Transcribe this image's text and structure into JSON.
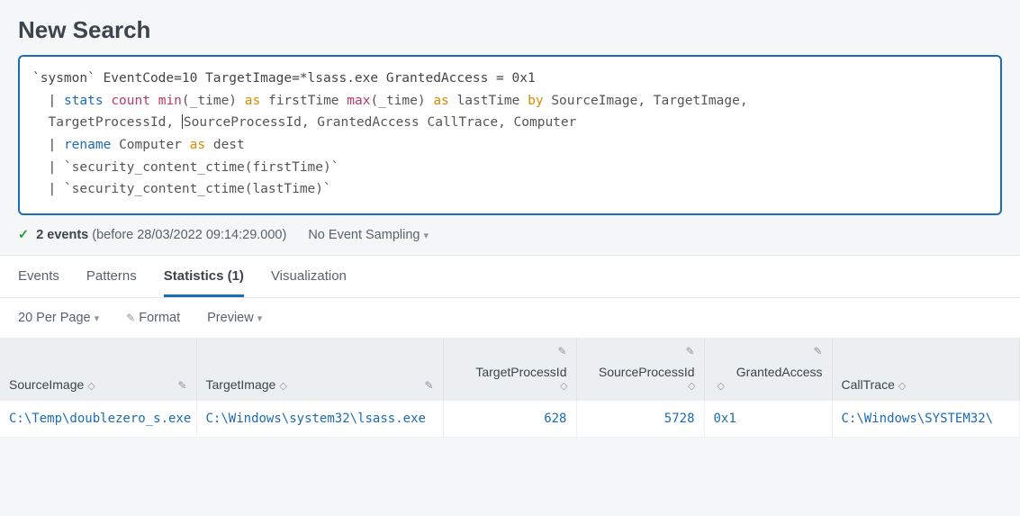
{
  "page_title": "New Search",
  "search_query": {
    "line1": "`sysmon` EventCode=10 TargetImage=*lsass.exe GrantedAccess = 0x1",
    "pipe": "|",
    "stats": "stats",
    "count": "count",
    "min": "min",
    "min_arg": "(_time)",
    "as": "as",
    "firstTime": "firstTime",
    "max": "max",
    "max_arg": "(_time)",
    "lastTime": "lastTime",
    "by": "by",
    "by_fields1": "SourceImage, TargetImage,",
    "by_fields2": "TargetProcessId, ",
    "by_fields2b": "SourceProcessId, GrantedAccess CallTrace, Computer",
    "rename": "rename",
    "rename_rest": "Computer",
    "dest": "dest",
    "ctime1": "`security_content_ctime(firstTime)`",
    "ctime2": "`security_content_ctime(lastTime)`"
  },
  "status": {
    "events_count": "2 events",
    "timestamp": " (before 28/03/2022 09:14:29.000)",
    "sampling": "No Event Sampling"
  },
  "tabs": {
    "events": "Events",
    "patterns": "Patterns",
    "statistics": "Statistics (1)",
    "visualization": "Visualization"
  },
  "toolbar": {
    "per_page": "20 Per Page",
    "format": "Format",
    "preview": "Preview"
  },
  "columns": {
    "source_image": "SourceImage",
    "target_image": "TargetImage",
    "target_pid": "TargetProcessId",
    "source_pid": "SourceProcessId",
    "granted_access": "GrantedAccess",
    "call_trace": "CallTrace"
  },
  "rows": [
    {
      "source_image": "C:\\Temp\\doublezero_s.exe",
      "target_image": "C:\\Windows\\system32\\lsass.exe",
      "target_pid": "628",
      "source_pid": "5728",
      "granted_access": "0x1",
      "call_trace": "C:\\Windows\\SYSTEM32\\"
    }
  ]
}
